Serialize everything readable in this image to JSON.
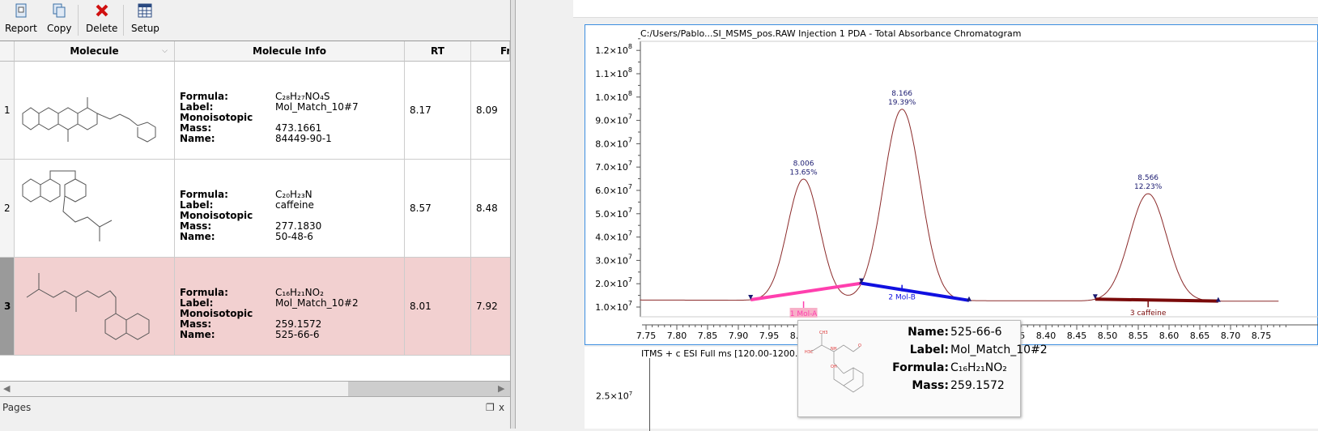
{
  "toolbar": {
    "report": "Report",
    "copy": "Copy",
    "delete": "Delete",
    "setup": "Setup"
  },
  "table": {
    "headers": {
      "molecule": "Molecule",
      "info": "Molecule Info",
      "rt": "RT",
      "fr": "Fr"
    },
    "info_keys": {
      "formula": "Formula:",
      "label": "Label:",
      "mass": "Monoisotopic Mass:",
      "name": "Name:"
    },
    "rows": [
      {
        "num": "1",
        "formula": "C₂₈H₂₇NO₄S",
        "label": "Mol_Match_10#7",
        "mass": "473.1661",
        "name": "84449-90-1",
        "rt": "8.17",
        "fr": "8.09",
        "selected": false
      },
      {
        "num": "2",
        "formula": "C₂₀H₂₃N",
        "label": "caffeine",
        "mass": "277.1830",
        "name": "50-48-6",
        "rt": "8.57",
        "fr": "8.48",
        "selected": false
      },
      {
        "num": "3",
        "formula": "C₁₆H₂₁NO₂",
        "label": "Mol_Match_10#2",
        "mass": "259.1572",
        "name": "525-66-6",
        "rt": "8.01",
        "fr": "7.92",
        "selected": true
      }
    ]
  },
  "pages_panel": {
    "title": "Pages"
  },
  "chart_data": {
    "type": "line",
    "title": "C:/Users/Pablo...SI_MSMS_pos.RAW Injection 1  PDA - Total Absorbance Chromatogram",
    "xlim": [
      7.75,
      8.78
    ],
    "ylim": [
      7000000.0,
      125000000.0
    ],
    "x_ticks": [
      "7.75",
      "7.80",
      "7.85",
      "7.90",
      "7.95",
      "8.00",
      "8.05",
      "8.10",
      "8.15",
      "8.20",
      "8.25",
      "8.30",
      "8.35",
      "8.40",
      "8.45",
      "8.50",
      "8.55",
      "8.60",
      "8.65",
      "8.70",
      "8.75"
    ],
    "y_ticks": [
      {
        "v": 10000000.0,
        "label": "1.0×10",
        "exp": "7"
      },
      {
        "v": 20000000.0,
        "label": "2.0×10",
        "exp": "7"
      },
      {
        "v": 30000000.0,
        "label": "3.0×10",
        "exp": "7"
      },
      {
        "v": 40000000.0,
        "label": "4.0×10",
        "exp": "7"
      },
      {
        "v": 50000000.0,
        "label": "5.0×10",
        "exp": "7"
      },
      {
        "v": 60000000.0,
        "label": "6.0×10",
        "exp": "7"
      },
      {
        "v": 70000000.0,
        "label": "7.0×10",
        "exp": "7"
      },
      {
        "v": 80000000.0,
        "label": "8.0×10",
        "exp": "7"
      },
      {
        "v": 90000000.0,
        "label": "9.0×10",
        "exp": "7"
      },
      {
        "v": 100000000.0,
        "label": "1.0×10",
        "exp": "8"
      },
      {
        "v": 110000000.0,
        "label": "1.1×10",
        "exp": "8"
      },
      {
        "v": 120000000.0,
        "label": "1.2×10",
        "exp": "8"
      }
    ],
    "baseline": 13000000.0,
    "line_color": "#8b2a2a",
    "peaks": [
      {
        "rt": "8.006",
        "percent": "13.65%",
        "apex": 65000000.0,
        "sigma": 0.026
      },
      {
        "rt": "8.166",
        "percent": "19.39%",
        "apex": 95000000.0,
        "sigma": 0.03
      },
      {
        "rt": "8.566",
        "percent": "12.23%",
        "apex": 59000000.0,
        "sigma": 0.03
      }
    ],
    "integrations": [
      {
        "label": "1 Mol-A",
        "start": 7.92,
        "end": 8.1,
        "center": 8.006,
        "color": "#ff3fae"
      },
      {
        "label": "2 Mol-B",
        "start": 8.1,
        "end": 8.275,
        "center": 8.166,
        "color": "#1010e0"
      },
      {
        "label": "3 caffeine",
        "start": 8.48,
        "end": 8.68,
        "center": 8.566,
        "color": "#7a0a0a"
      }
    ]
  },
  "lower_chart": {
    "title": "ITMS + c ESI Full ms [120.00-1200.00",
    "y_tick": "2.5×10",
    "y_exp": "7"
  },
  "tooltip": {
    "name_label": "Name:",
    "name": "525-66-6",
    "label_label": "Label:",
    "label": "Mol_Match_10#2",
    "formula_label": "Formula:",
    "formula": "C₁₆H₂₁NO₂",
    "mass_label": "Mass:",
    "mass": "259.1572"
  }
}
